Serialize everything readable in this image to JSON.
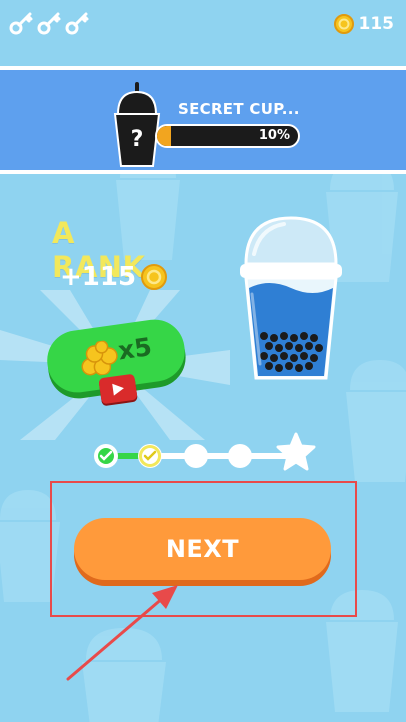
{
  "header": {
    "keys": [
      "key-icon",
      "key-icon",
      "key-icon"
    ],
    "coin_icon": "coin-icon",
    "coin_count": "115"
  },
  "secret_cup": {
    "icon": "mystery-cup-icon",
    "symbol": "?",
    "title": "SECRET CUP...",
    "progress_label": "10%",
    "progress_fraction": 0.1
  },
  "result": {
    "rank": "A RANK",
    "reward": "+115",
    "reward_icon": "coin-icon"
  },
  "multiplier": {
    "label": "x5",
    "icon": "coin-pile-icon",
    "video_icon": "video-play-icon"
  },
  "level_progress": {
    "nodes": [
      "completed",
      "current",
      "empty",
      "empty"
    ],
    "goal_icon": "star-icon"
  },
  "next_button": {
    "label": "NEXT"
  },
  "colors": {
    "background": "#8fd3f0",
    "banner": "#5ea0ee",
    "progress_fill": "#f2a51f",
    "rank_text": "#f2e85c",
    "multiplier_pill": "#36d647",
    "next_button": "#ff9a3b",
    "highlight_frame": "#e84a4a",
    "annotation_arrow": "#e84a4a"
  }
}
